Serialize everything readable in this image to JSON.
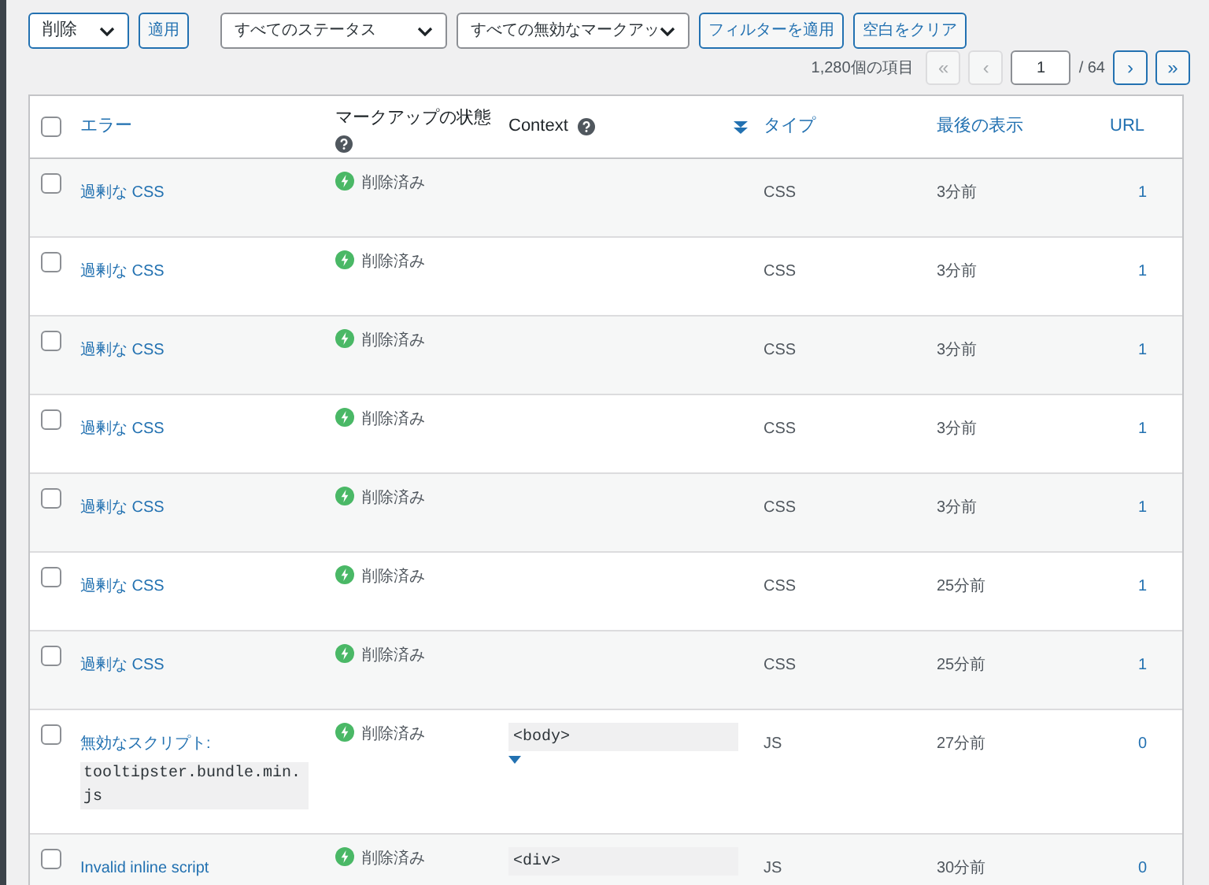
{
  "toolbar": {
    "bulk_action": "削除",
    "apply": "適用",
    "status_filter": "すべてのステータス",
    "markup_filter": "すべての無効なマークアッ",
    "filter_button": "フィルターを適用",
    "clear_button": "空白をクリア"
  },
  "pagination": {
    "count": "1,280個の項目",
    "first": "«",
    "prev": "‹",
    "page": "1",
    "total": "/ 64",
    "next": "›",
    "last": "»"
  },
  "table": {
    "select_all_checked": false,
    "columns": [
      {
        "label": "エラー",
        "kind": "link"
      },
      {
        "label": "マークアップの状態",
        "kind": "help"
      },
      {
        "label": "Context",
        "kind": "help_sort"
      },
      {
        "label": "タイプ",
        "kind": "link"
      },
      {
        "label": "最後の表示",
        "kind": "link"
      },
      {
        "label": "URL",
        "kind": "link"
      }
    ],
    "rows": [
      {
        "error": "過剰な CSS",
        "status": "削除済み",
        "type": "CSS",
        "last_seen": "3分前",
        "url": "1",
        "checked": false
      },
      {
        "error": "過剰な CSS",
        "status": "削除済み",
        "type": "CSS",
        "last_seen": "3分前",
        "url": "1",
        "checked": false
      },
      {
        "error": "過剰な CSS",
        "status": "削除済み",
        "type": "CSS",
        "last_seen": "3分前",
        "url": "1",
        "checked": false
      },
      {
        "error": "過剰な CSS",
        "status": "削除済み",
        "type": "CSS",
        "last_seen": "3分前",
        "url": "1",
        "checked": false
      },
      {
        "error": "過剰な CSS",
        "status": "削除済み",
        "type": "CSS",
        "last_seen": "3分前",
        "url": "1",
        "checked": false
      },
      {
        "error": "過剰な CSS",
        "status": "削除済み",
        "type": "CSS",
        "last_seen": "25分前",
        "url": "1",
        "checked": false
      },
      {
        "error": "過剰な CSS",
        "status": "削除済み",
        "type": "CSS",
        "last_seen": "25分前",
        "url": "1",
        "checked": false
      },
      {
        "error": "無効なスクリプト:",
        "code": "tooltipster.bundle.min.js",
        "status": "削除済み",
        "context": "<body>",
        "expandable": true,
        "type": "JS",
        "last_seen": "27分前",
        "url": "0",
        "checked": false
      },
      {
        "error": "Invalid inline script",
        "status": "削除済み",
        "context": "<div>",
        "type": "JS",
        "last_seen": "30分前",
        "url": "0",
        "checked": false
      }
    ]
  }
}
